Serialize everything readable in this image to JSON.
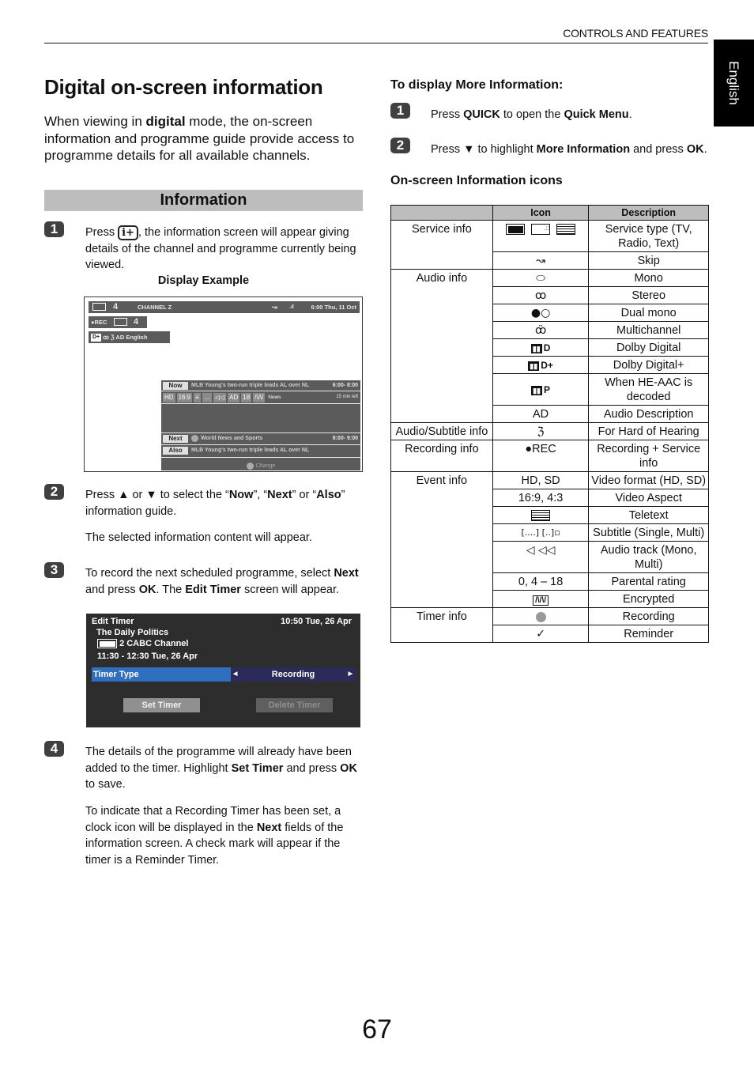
{
  "header": {
    "section": "CONTROLS AND FEATURES",
    "language_tab": "English"
  },
  "page": {
    "title": "Digital on-screen information",
    "intro_pre": "When viewing in ",
    "intro_bold": "digital",
    "intro_post": " mode, the on-screen information and programme guide provide access to programme details for all available channels.",
    "number": "67"
  },
  "information": {
    "heading": "Information",
    "steps": [
      {
        "num": "1",
        "pre": "Press ",
        "key": "i+",
        "post": ", the information screen will appear giving details of the channel and programme currently being viewed."
      },
      {
        "num": "2",
        "p1": "Press ▲ or ▼ to select the “",
        "b1": "Now",
        "p2": "”, “",
        "b2": "Next",
        "p3": "” or “",
        "b3": "Also",
        "p4": "” information guide.",
        "note": "The selected information content will appear."
      },
      {
        "num": "3",
        "p1": "To record the next scheduled programme, select ",
        "b1": "Next",
        "p2": " and press ",
        "b2": "OK",
        "p3": ". The ",
        "b3": "Edit Timer",
        "p4": " screen will appear."
      },
      {
        "num": "4",
        "p1": "The details of the programme will already have been added to the timer. Highlight ",
        "b1": "Set Timer",
        "p2": " and press ",
        "b2": "OK",
        "p3": " to save.",
        "n1": "To indicate that a Recording Timer has been set, a clock icon will be displayed in the ",
        "nb": "Next",
        "n2": " fields of the information screen. A check mark will appear if the timer is a Reminder Timer."
      }
    ],
    "display_example_label": "Display Example"
  },
  "info_screen": {
    "channel_num": "4",
    "channel_name": "CHANNEL Z",
    "skip_icon": "↝",
    "signal_icon": ".ıl",
    "datetime": "6:00 Thu, 11 Oct",
    "rec_label": "●REC",
    "rec_channel": "4",
    "dolby": "D+",
    "stereo_icon": "ꝏ",
    "hoh_icon": "ℨ",
    "ad_text": "AD English",
    "now": {
      "tag": "Now",
      "title": "MLB Young's two-run triple leads AL over NL",
      "time": "6:00- 8:00"
    },
    "chips": [
      "HD",
      "16:9",
      "≡",
      "…",
      "◁◁",
      "AD",
      "18",
      "/\\/\\/"
    ],
    "genre": "News",
    "time_left": "15 min left",
    "next": {
      "tag": "Next",
      "title": "World News and Sports",
      "time": "8:00- 9:00"
    },
    "also": {
      "tag": "Also",
      "title": "MLB Young's two-run triple leads AL over NL"
    },
    "change_label": "Change"
  },
  "edit_timer": {
    "title": "Edit Timer",
    "clock": "10:50 Tue, 26 Apr",
    "programme": "The Daily Politics",
    "channel": "2 CABC Channel",
    "when": "11:30 - 12:30 Tue, 26 Apr",
    "field_label": "Timer Type",
    "field_value": "Recording",
    "set_button": "Set Timer",
    "delete_button": "Delete Timer"
  },
  "more_info": {
    "heading": "To display More Information:",
    "steps": [
      {
        "num": "1",
        "p1": "Press ",
        "b1": "QUICK",
        "p2": " to open the ",
        "b2": "Quick Menu",
        "p3": "."
      },
      {
        "num": "2",
        "p1": "Press ▼ to highlight ",
        "b1": "More Information",
        "p2": " and press ",
        "b2": "OK",
        "p3": "."
      }
    ]
  },
  "icons_table": {
    "heading": "On-screen Information icons",
    "columns": [
      "",
      "Icon",
      "Description"
    ],
    "rows": [
      {
        "group": "Service info",
        "icon": "tv-radio-text-icons",
        "desc": "Service type (TV, Radio, Text)"
      },
      {
        "group": "",
        "icon": "↝",
        "desc": "Skip"
      },
      {
        "group": "Audio info",
        "icon": "⬭",
        "desc": "Mono"
      },
      {
        "group": "",
        "icon": "ꝏ",
        "desc": "Stereo"
      },
      {
        "group": "",
        "icon": "●○",
        "desc": "Dual mono"
      },
      {
        "group": "",
        "icon": "ꝏ̈",
        "desc": "Multichannel"
      },
      {
        "group": "",
        "icon": "D",
        "desc": "Dolby Digital"
      },
      {
        "group": "",
        "icon": "D+",
        "desc": "Dolby Digital+"
      },
      {
        "group": "",
        "icon": "P",
        "desc": "When HE-AAC is decoded"
      },
      {
        "group": "",
        "icon": "AD",
        "desc": "Audio Description"
      },
      {
        "group": "Audio/Subtitle info",
        "icon": "ℨ",
        "desc": "For Hard of Hearing"
      },
      {
        "group": "Recording info",
        "icon": "●REC",
        "desc": "Recording + Service info"
      },
      {
        "group": "Event info",
        "icon": "HD, SD",
        "desc": "Video format (HD, SD)"
      },
      {
        "group": "",
        "icon": "16:9, 4:3",
        "desc": "Video Aspect"
      },
      {
        "group": "",
        "icon": "≣",
        "desc": "Teletext"
      },
      {
        "group": "",
        "icon": "[....]  [..]▫",
        "desc": "Subtitle (Single, Multi)"
      },
      {
        "group": "",
        "icon": "◁  ◁◁",
        "desc": "Audio track (Mono, Multi)"
      },
      {
        "group": "",
        "icon": "0, 4 – 18",
        "desc": "Parental rating"
      },
      {
        "group": "",
        "icon": "/\\/\\/",
        "desc": "Encrypted"
      },
      {
        "group": "Timer info",
        "icon": "clock",
        "desc": "Recording"
      },
      {
        "group": "",
        "icon": "✓",
        "desc": "Reminder"
      }
    ]
  }
}
